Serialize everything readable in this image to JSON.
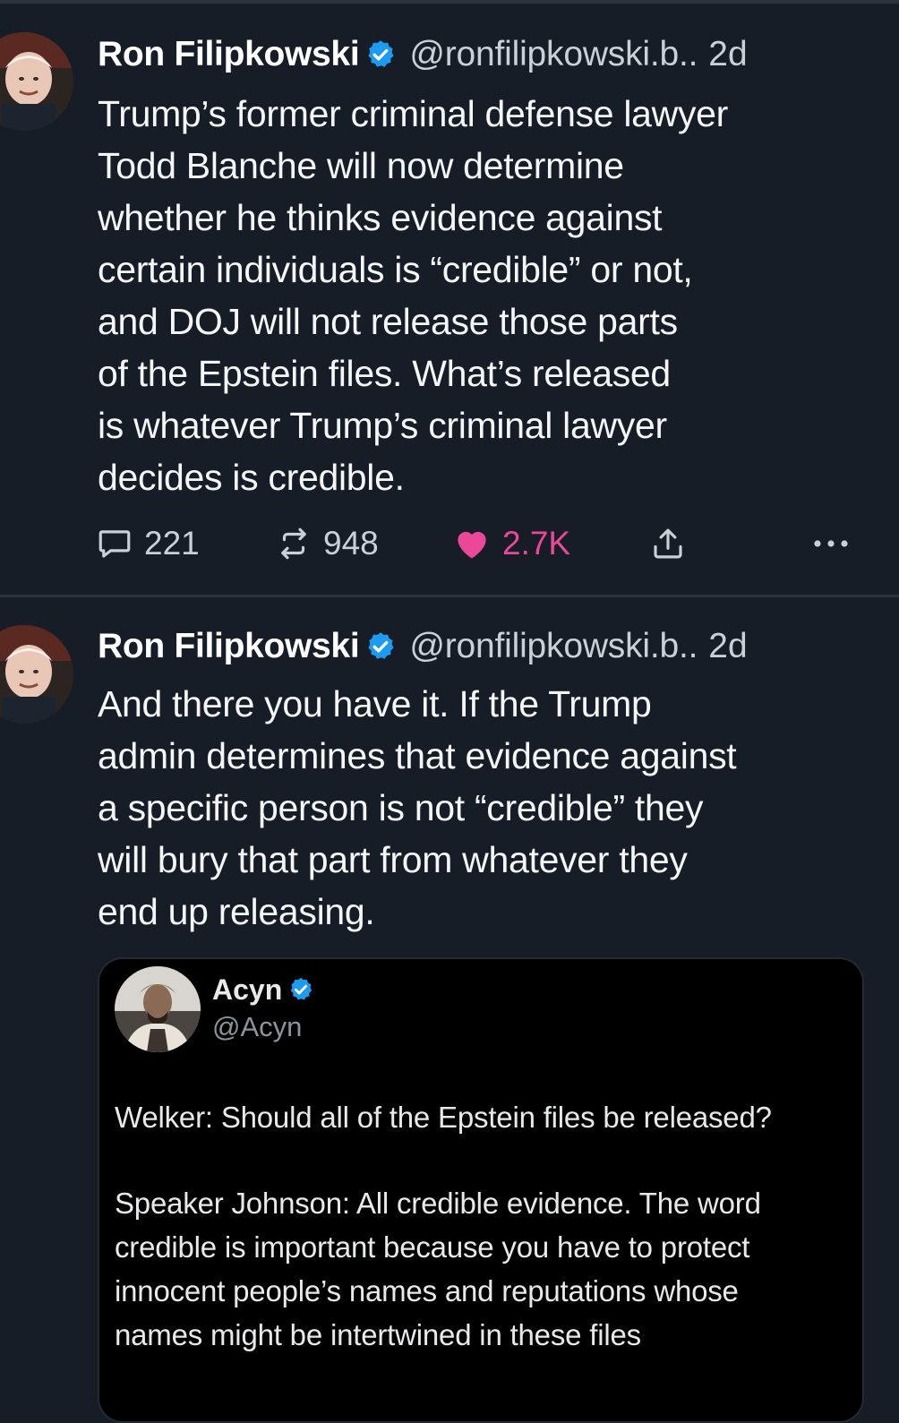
{
  "colors": {
    "background": "#161d26",
    "text": "#f5f6f7",
    "muted": "#c9d0d8",
    "like": "#ec4899",
    "verified": "#1d9bf0",
    "quote_bg": "#000000"
  },
  "posts": [
    {
      "author_name": "Ron Filipkowski",
      "handle": "@ronfilipkowski.b..",
      "time": "2d",
      "body_lines": [
        "Trump’s former criminal defense lawyer",
        "Todd Blanche will now determine",
        "whether he thinks evidence against",
        "certain individuals is “credible” or not,",
        "and DOJ will not release those parts",
        "of the Epstein files. What’s released",
        "is whatever Trump’s criminal lawyer",
        "decides is credible."
      ],
      "replies": "221",
      "reposts": "948",
      "likes": "2.7K"
    },
    {
      "author_name": "Ron Filipkowski",
      "handle": "@ronfilipkowski.b..",
      "time": "2d",
      "body_lines": [
        "And there you have it. If the Trump",
        "admin determines that evidence against",
        "a specific person is not “credible” they",
        "will bury that part from whatever they",
        "end up releasing."
      ],
      "quote": {
        "author_name": "Acyn",
        "handle": "@Acyn",
        "paragraph1_lines": [
          "Welker: Should all of the Epstein files be released?"
        ],
        "paragraph2_lines": [
          "Speaker Johnson: All credible evidence. The word",
          "credible is important because you have to protect",
          "innocent people’s names and reputations whose",
          "names might be intertwined in these files"
        ]
      }
    }
  ]
}
